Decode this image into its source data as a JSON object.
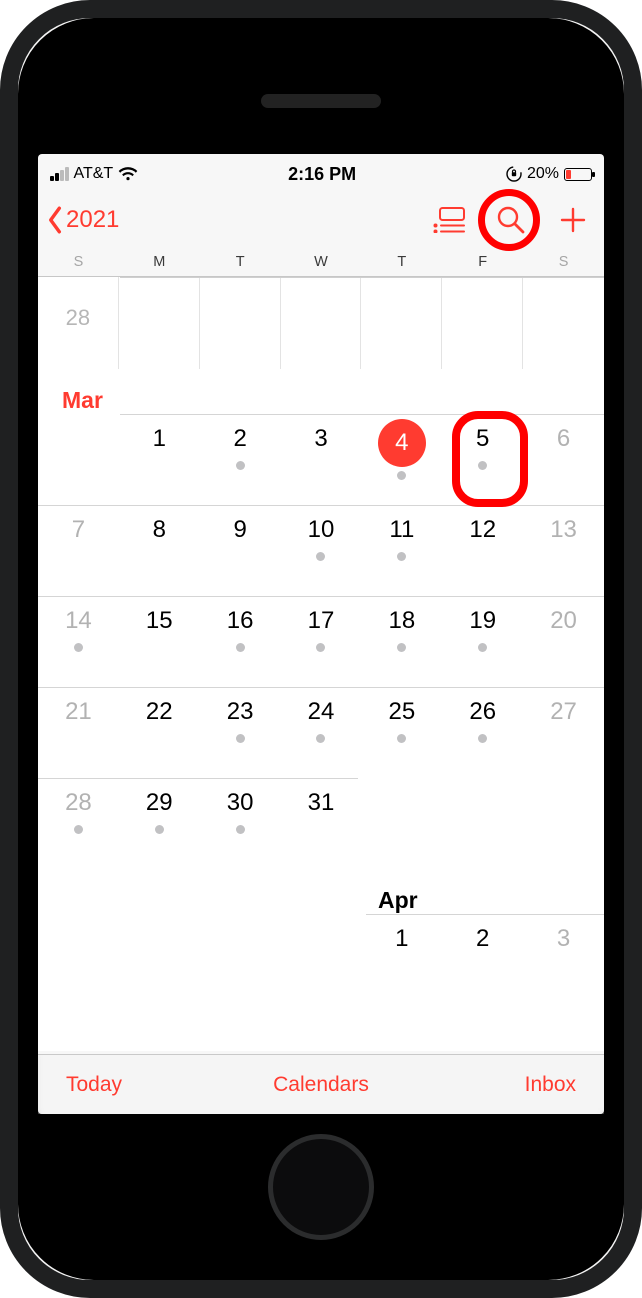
{
  "statusbar": {
    "carrier": "AT&T",
    "time": "2:16 PM",
    "battery_pct": "20%",
    "signal_bars_active": 2
  },
  "nav": {
    "back_label": "2021"
  },
  "weekdays": [
    "S",
    "M",
    "T",
    "W",
    "T",
    "F",
    "S"
  ],
  "prev_month_trailing": {
    "label": "28"
  },
  "month1": {
    "label": "Mar",
    "weeks": [
      [
        {
          "d": "",
          "dot": false
        },
        {
          "d": "1",
          "dot": false
        },
        {
          "d": "2",
          "dot": true
        },
        {
          "d": "3",
          "dot": false
        },
        {
          "d": "4",
          "dot": true,
          "today": true
        },
        {
          "d": "5",
          "dot": true,
          "highlight": true
        },
        {
          "d": "6",
          "dot": false,
          "weekend": true
        }
      ],
      [
        {
          "d": "7",
          "dot": false,
          "weekend": true
        },
        {
          "d": "8",
          "dot": false
        },
        {
          "d": "9",
          "dot": false
        },
        {
          "d": "10",
          "dot": true
        },
        {
          "d": "11",
          "dot": true
        },
        {
          "d": "12",
          "dot": false
        },
        {
          "d": "13",
          "dot": false,
          "weekend": true
        }
      ],
      [
        {
          "d": "14",
          "dot": true,
          "weekend": true
        },
        {
          "d": "15",
          "dot": false
        },
        {
          "d": "16",
          "dot": true
        },
        {
          "d": "17",
          "dot": true
        },
        {
          "d": "18",
          "dot": true
        },
        {
          "d": "19",
          "dot": true
        },
        {
          "d": "20",
          "dot": false,
          "weekend": true
        }
      ],
      [
        {
          "d": "21",
          "dot": false,
          "weekend": true
        },
        {
          "d": "22",
          "dot": false
        },
        {
          "d": "23",
          "dot": true
        },
        {
          "d": "24",
          "dot": true
        },
        {
          "d": "25",
          "dot": true
        },
        {
          "d": "26",
          "dot": true
        },
        {
          "d": "27",
          "dot": false,
          "weekend": true
        }
      ],
      [
        {
          "d": "28",
          "dot": true,
          "weekend": true
        },
        {
          "d": "29",
          "dot": true
        },
        {
          "d": "30",
          "dot": true
        },
        {
          "d": "31",
          "dot": false
        },
        {
          "d": "",
          "dot": false
        },
        {
          "d": "",
          "dot": false
        },
        {
          "d": "",
          "dot": false
        }
      ]
    ]
  },
  "month2": {
    "label": "Apr",
    "weeks": [
      [
        {
          "d": "",
          "dot": false
        },
        {
          "d": "",
          "dot": false
        },
        {
          "d": "",
          "dot": false
        },
        {
          "d": "",
          "dot": false
        },
        {
          "d": "1",
          "dot": false
        },
        {
          "d": "2",
          "dot": false
        },
        {
          "d": "3",
          "dot": false,
          "weekend": true
        }
      ]
    ]
  },
  "toolbar": {
    "today": "Today",
    "calendars": "Calendars",
    "inbox": "Inbox"
  },
  "annotations": {
    "search_circle": true,
    "day5_round_rect": true
  },
  "colors": {
    "accent": "#ff3b30"
  }
}
